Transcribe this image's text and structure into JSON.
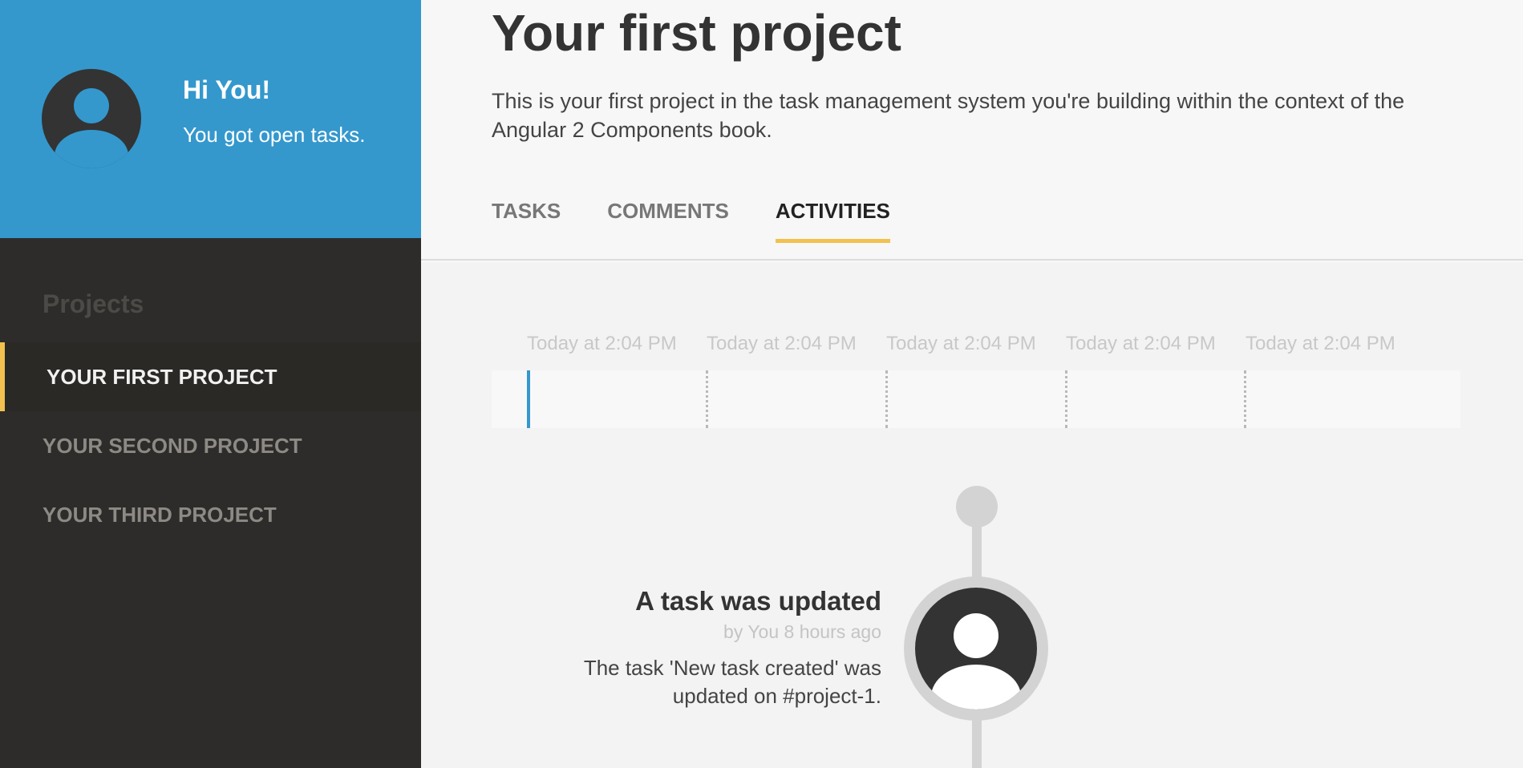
{
  "profile": {
    "greeting": "Hi You!",
    "subline": "You got open tasks.",
    "avatar_icon": "user-avatar-icon"
  },
  "nav": {
    "title": "Projects",
    "items": [
      {
        "label": "YOUR FIRST PROJECT",
        "active": true
      },
      {
        "label": "YOUR SECOND PROJECT",
        "active": false
      },
      {
        "label": "YOUR THIRD PROJECT",
        "active": false
      }
    ]
  },
  "header": {
    "title": "Your first project",
    "description": "This is your first project in the task management system you're building within the context of the Angular 2 Components book.",
    "tabs": [
      {
        "label": "TASKS",
        "active": false
      },
      {
        "label": "COMMENTS",
        "active": false
      },
      {
        "label": "ACTIVITIES",
        "active": true
      }
    ]
  },
  "slider": {
    "labels": [
      "Today at 2:04 PM",
      "Today at 2:04 PM",
      "Today at 2:04 PM",
      "Today at 2:04 PM",
      "Today at 2:04 PM"
    ]
  },
  "activity": {
    "title": "A task was updated",
    "meta": "by You 8 hours ago",
    "body": "The task 'New task created' was updated on #project-1."
  },
  "colors": {
    "brand_blue": "#3498cd",
    "sidebar_dark": "#2d2c2a",
    "accent_yellow": "#f2c14e"
  }
}
